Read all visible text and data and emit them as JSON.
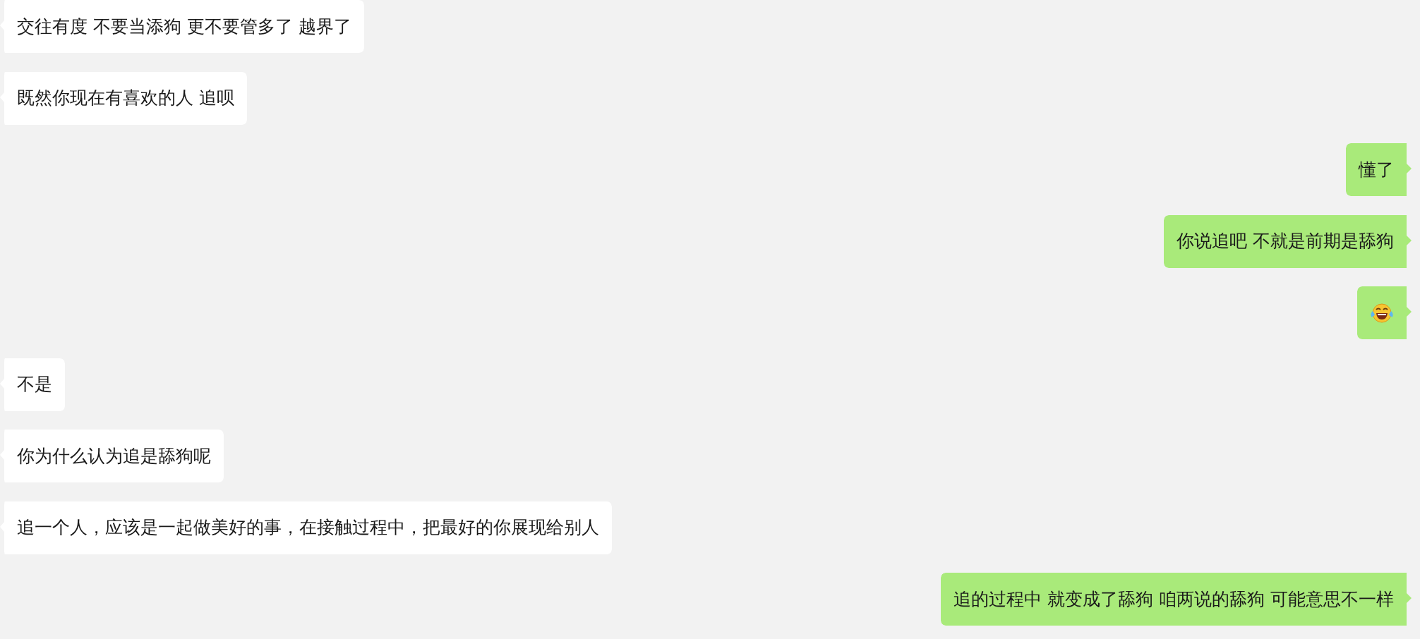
{
  "messages": [
    {
      "outgoing": false,
      "kind": "text",
      "text": "交往有度 不要当添狗 更不要管多了 越界了"
    },
    {
      "outgoing": false,
      "kind": "text",
      "text": "既然你现在有喜欢的人 追呗"
    },
    {
      "outgoing": true,
      "kind": "text",
      "text": "懂了"
    },
    {
      "outgoing": true,
      "kind": "text",
      "text": "你说追吧 不就是前期是舔狗"
    },
    {
      "outgoing": true,
      "kind": "emoji"
    },
    {
      "outgoing": false,
      "kind": "text",
      "text": "不是"
    },
    {
      "outgoing": false,
      "kind": "text",
      "text": "你为什么认为追是舔狗呢"
    },
    {
      "outgoing": false,
      "kind": "text",
      "text": "追一个人，应该是一起做美好的事，在接触过程中，把最好的你展现给别人"
    },
    {
      "outgoing": true,
      "kind": "text",
      "text": "追的过程中 就变成了舔狗 咱两说的舔狗 可能意思不一样"
    }
  ]
}
